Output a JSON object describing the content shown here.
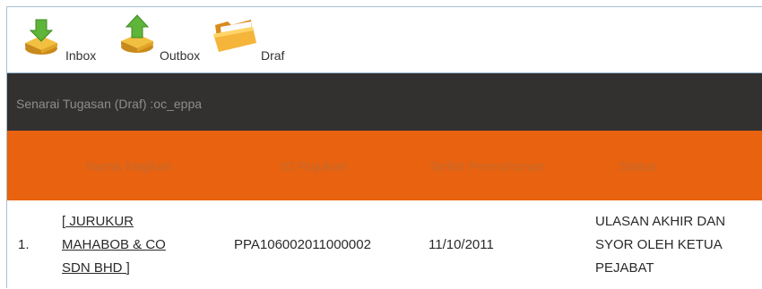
{
  "toolbar": {
    "items": [
      {
        "label": "Inbox",
        "icon": "inbox-icon"
      },
      {
        "label": "Outbox",
        "icon": "outbox-icon"
      },
      {
        "label": "Draf",
        "icon": "folder-icon"
      }
    ]
  },
  "panel": {
    "title": "Senarai Tugasan (Draf) :oc_eppa"
  },
  "table": {
    "columns": [
      "Nama Majikan",
      "ID Rujukan",
      "Tarikh Permohonan",
      "Status"
    ],
    "rows": [
      {
        "no": "1.",
        "majikan_lines": [
          "[ JURUKUR",
          "MAHABOB & CO",
          "SDN BHD ]"
        ],
        "id_rujukan": "PPA106002011000002",
        "tarikh": "11/10/2011",
        "status_lines": [
          "ULASAN AKHIR DAN",
          "SYOR OLEH KETUA",
          "PEJABAT"
        ]
      }
    ]
  },
  "colors": {
    "title_bar_bg": "#333030",
    "header_bg": "#e8620f",
    "header_text": "#c66a2e",
    "border": "#8fb0c9"
  }
}
